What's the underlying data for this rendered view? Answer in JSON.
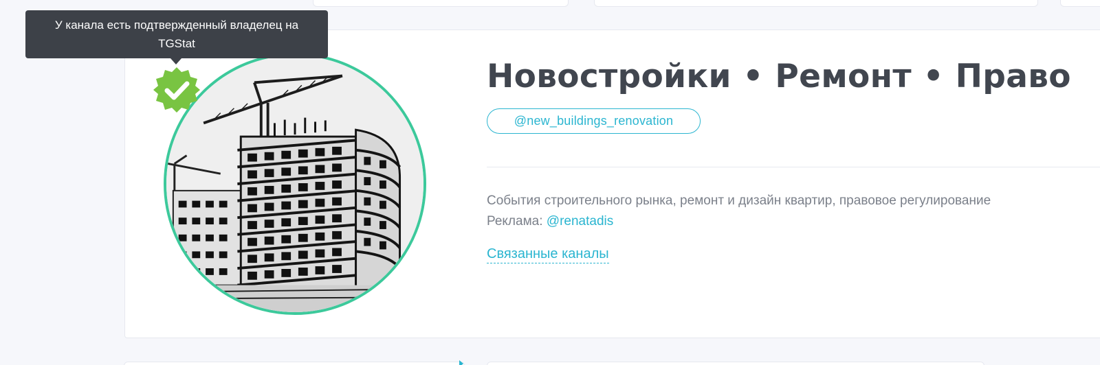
{
  "tooltip": {
    "text": "У канала есть подтвержденный владелец на TGStat"
  },
  "channel": {
    "title": "Новостройки • Ремонт • Право",
    "username": "@new_buildings_renovation",
    "description": "События строительного рынка, ремонт и дизайн квартир, правовое регулирование",
    "ads_label": "Реклама: ",
    "ads_contact": "@renatadis",
    "related_label": "Связанные каналы"
  },
  "icons": {
    "verified": "verified-check-icon"
  },
  "colors": {
    "accent": "#2ab5d0",
    "avatar_ring": "#3cc99b",
    "verified_badge": "#79c442",
    "tooltip_bg": "#3d4148",
    "title": "#41464f"
  }
}
